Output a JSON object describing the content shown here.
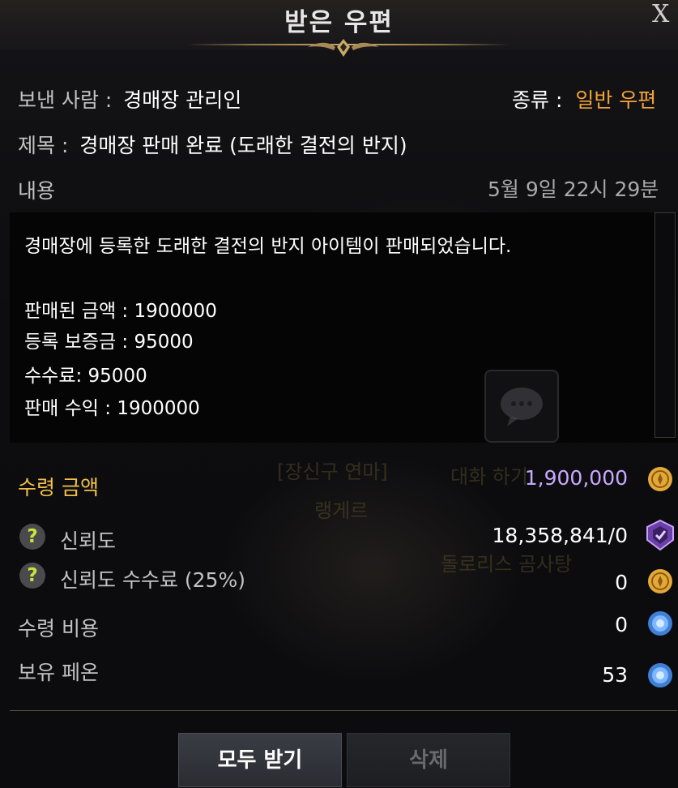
{
  "window": {
    "title": "받은 우편",
    "close_glyph": "X"
  },
  "mail": {
    "sender_label": "보낸 사람 :",
    "sender_value": "경매장 관리인",
    "type_label": "종류 :",
    "type_value": "일반 우편",
    "subject_label": "제목 :",
    "subject_value": "경매장 판매 완료 (도래한 결전의 반지)",
    "content_label": "내용",
    "date": "5월 9일 22시 29분",
    "body_lines": [
      "경매장에 등록한 도래한 결전의 반지 아이템이 판매되었습니다.",
      "판매된 금액 : 1900000",
      "등록 보증금 : 95000",
      "수수료: 95000",
      "판매 수익 : 1900000"
    ]
  },
  "background_ghost": {
    "line1": "[장신구 연마]",
    "line2": "대화 하기",
    "line3": "랭게르",
    "line4": "돌로리스 곰사탕"
  },
  "rewards": {
    "receive_amount_label": "수령 금액",
    "receive_amount_value": "1,900,000",
    "trust_label": "신뢰도",
    "trust_value": "18,358,841/0",
    "trust_fee_label": "신뢰도 수수료 (25%)",
    "trust_fee_value": "0",
    "receive_cost_label": "수령 비용",
    "receive_cost_value": "0",
    "owned_peon_label": "보유 페온",
    "owned_peon_value": "53",
    "help_glyph": "?"
  },
  "icons": {
    "gold": "gold-coin-icon",
    "trust": "trust-shield-icon",
    "peon": "blue-peon-icon",
    "chat": "chat-bubble-icon"
  },
  "colors": {
    "accent_gold": "#f2a33a",
    "amount_purple": "#c9a8ff",
    "label_gold": "#f0c04a",
    "help_green": "#c8e33a"
  },
  "buttons": {
    "receive_all": "모두 받기",
    "delete": "삭제"
  }
}
